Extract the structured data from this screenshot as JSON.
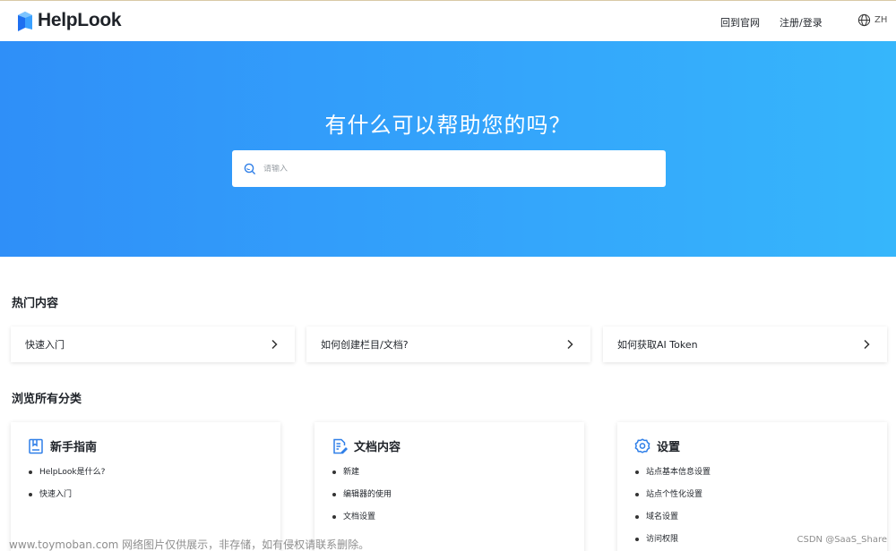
{
  "header": {
    "brand": "HelpLook",
    "nav": {
      "back_to_site": "回到官网",
      "register_login": "注册/登录"
    },
    "language": "ZH"
  },
  "hero": {
    "title": "有什么可以帮助您的吗？",
    "search_placeholder": "请输入"
  },
  "hot": {
    "title": "热门内容",
    "items": [
      {
        "label": "快速入门"
      },
      {
        "label": "如何创建栏目/文档?"
      },
      {
        "label": "如何获取AI Token"
      }
    ]
  },
  "categories": {
    "title": "浏览所有分类",
    "cards": [
      {
        "title": "新手指南",
        "icon": "book-icon",
        "items": [
          "HelpLook是什么?",
          "快速入门"
        ]
      },
      {
        "title": "文档内容",
        "icon": "document-edit-icon",
        "items": [
          "新建",
          "编辑器的使用",
          "文档设置"
        ]
      },
      {
        "title": "设置",
        "icon": "gear-icon",
        "items": [
          "站点基本信息设置",
          "站点个性化设置",
          "域名设置",
          "访问权限"
        ]
      }
    ]
  },
  "watermark": {
    "left": "www.toymoban.com 网络图片仅供展示，非存储，如有侵权请联系删除。",
    "right": "CSDN @SaaS_Share"
  },
  "colors": {
    "accent": "#2f8ff8",
    "hero_end": "#36b6fb",
    "icon_blue": "#2f7fe8"
  }
}
